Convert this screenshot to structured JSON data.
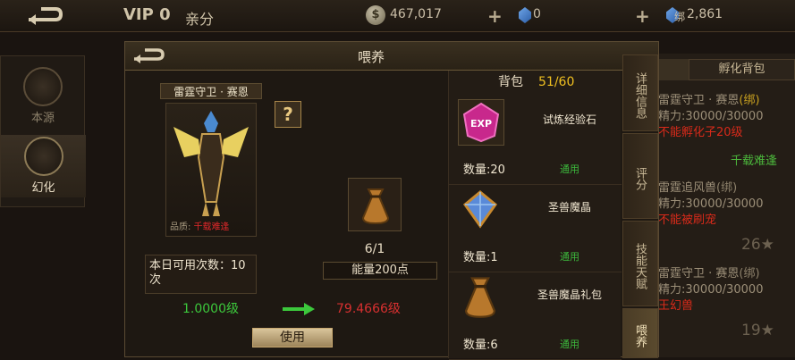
{
  "topbar": {
    "vip": "VIP 0",
    "relation": "亲分",
    "gold": "467,017",
    "gems": "0",
    "bound_gems": "2,861",
    "bound_prefix": "绑",
    "coin_symbol": "$"
  },
  "leftnav": [
    {
      "label": "本源"
    },
    {
      "label": "幻化"
    }
  ],
  "background": {
    "tab_hatch": "孵化背包",
    "items": [
      {
        "name": "雷霆守卫 · 赛恩",
        "tag": "(绑)",
        "stat": "精力:30000/30000",
        "warn": "不能孵化子20级",
        "rarity": "千载难逢"
      },
      {
        "name": "雷霆追风兽",
        "tag": "(绑)",
        "stat": "精力:30000/30000",
        "warn": "不能被刷宠",
        "stars": "26★"
      },
      {
        "name": "雷霆守卫 · 赛恩",
        "tag": "(绑)",
        "stat": "精力:30000/30000",
        "warn": "王幻兽",
        "stars": "19★"
      }
    ]
  },
  "modal": {
    "title": "喂养",
    "char_name": "雷霆守卫 · 赛恩",
    "quality_label": "品质:",
    "quality_value": "千载难逢",
    "help": "?",
    "item_count": "6/1",
    "energy": "能量200点",
    "uses_label": "本日可用次数：10次",
    "level_current": "1.0000级",
    "level_next": "79.4666级",
    "use_button": "使用"
  },
  "bag": {
    "title": "背包",
    "capacity": "51/60",
    "items": [
      {
        "name": "试炼经验石",
        "qty": "数量:20",
        "status": "通用",
        "icon": "exp-stone-icon",
        "icon_text": "EXP"
      },
      {
        "name": "圣兽魔晶",
        "qty": "数量:1",
        "status": "通用",
        "icon": "crystal-icon"
      },
      {
        "name": "圣兽魔晶礼包",
        "qty": "数量:6",
        "status": "通用",
        "icon": "pouch-icon"
      }
    ]
  },
  "sidetabs": [
    "详细信息",
    "评分",
    "技能天赋",
    "喂养"
  ],
  "colors": {
    "accent": "#f0c020",
    "green": "#3cc83c",
    "red": "#d83030"
  }
}
